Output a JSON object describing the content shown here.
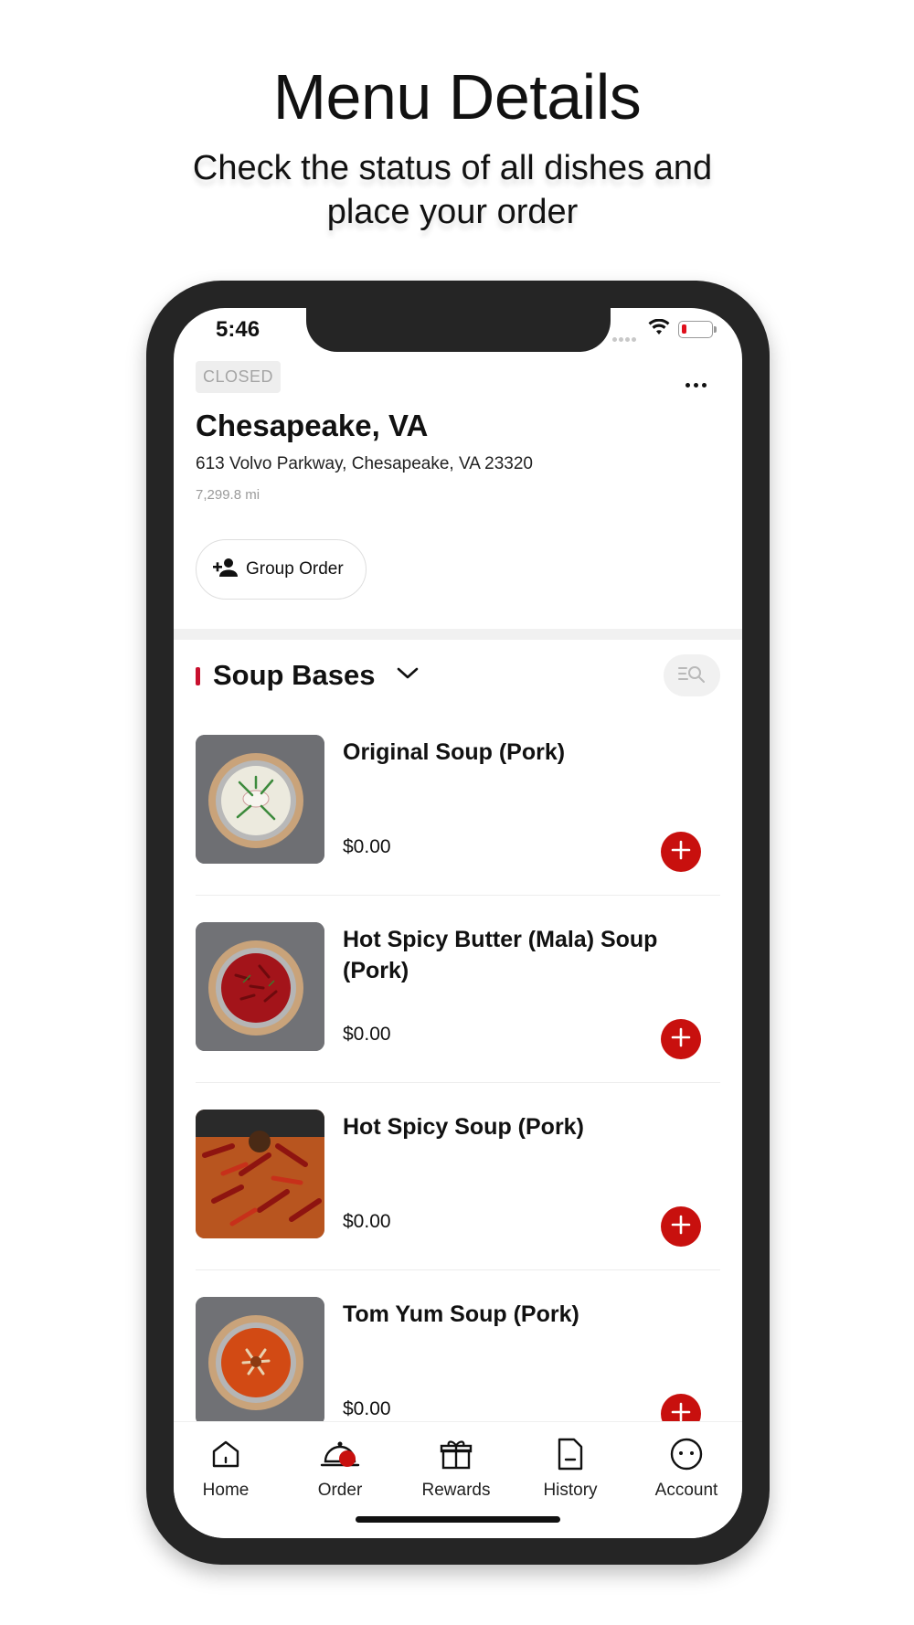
{
  "promo": {
    "title": "Menu Details",
    "subtitle_line1": "Check the status of all dishes and",
    "subtitle_line2": "place your order"
  },
  "status_bar": {
    "time": "5:46",
    "battery_color": "#e0101c"
  },
  "store": {
    "status_badge": "CLOSED",
    "name": "Chesapeake, VA",
    "address": "613 Volvo Parkway, Chesapeake, VA 23320",
    "distance": "7,299.8 mi",
    "group_order_label": "Group Order"
  },
  "category": {
    "title": "Soup Bases",
    "accent_color": "#c8102e"
  },
  "items": [
    {
      "name": "Original Soup (Pork)",
      "price": "$0.00",
      "icon": "white-soup-bowl-photo"
    },
    {
      "name": "Hot Spicy Butter (Mala) Soup (Pork)",
      "price": "$0.00",
      "icon": "red-chili-soup-bowl-photo"
    },
    {
      "name": "Hot Spicy Soup (Pork)",
      "price": "$0.00",
      "icon": "dried-chili-soup-photo"
    },
    {
      "name": "Tom Yum Soup (Pork)",
      "price": "$0.00",
      "icon": "tom-yum-soup-bowl-photo"
    }
  ],
  "add_button_color": "#c8100e",
  "tabs": [
    {
      "label": "Home",
      "icon": "home-icon"
    },
    {
      "label": "Order",
      "icon": "order-cloche-icon"
    },
    {
      "label": "Rewards",
      "icon": "gift-icon"
    },
    {
      "label": "History",
      "icon": "document-icon"
    },
    {
      "label": "Account",
      "icon": "account-face-icon"
    }
  ],
  "active_tab": "Order"
}
